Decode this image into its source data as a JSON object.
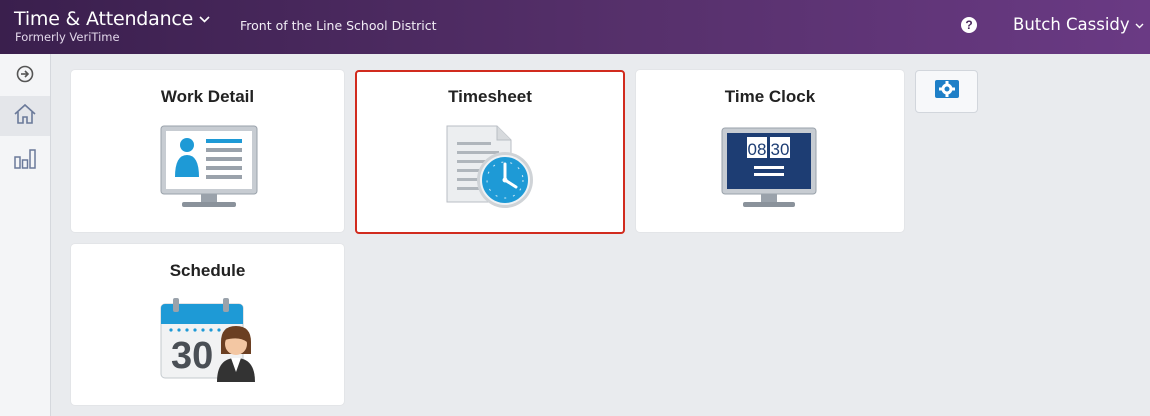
{
  "header": {
    "app_title": "Time & Attendance",
    "app_subtitle": "Formerly VeriTime",
    "district": "Front of the Line School District",
    "help_glyph": "?",
    "user_name": "Butch Cassidy",
    "chevron": "⌄"
  },
  "sidebar": {
    "items": [
      {
        "icon": "arrow-right-circle-icon"
      },
      {
        "icon": "home-icon",
        "active": true
      },
      {
        "icon": "bar-chart-icon"
      }
    ]
  },
  "tiles": [
    {
      "title": "Work Detail",
      "icon": "id-card-monitor-icon"
    },
    {
      "title": "Timesheet",
      "icon": "timesheet-clock-icon",
      "selected": true
    },
    {
      "title": "Time Clock",
      "icon": "flip-clock-monitor-icon",
      "clock_hour": "08",
      "clock_minute": "30"
    },
    {
      "title": "Schedule",
      "icon": "calendar-person-icon",
      "calendar_day": "30"
    }
  ],
  "settings": {
    "icon": "gear-icon"
  },
  "colors": {
    "header_start": "#3a1f4d",
    "header_end": "#6a3a84",
    "selection_border": "#d12b1e",
    "accent_blue": "#1e9ad6"
  }
}
